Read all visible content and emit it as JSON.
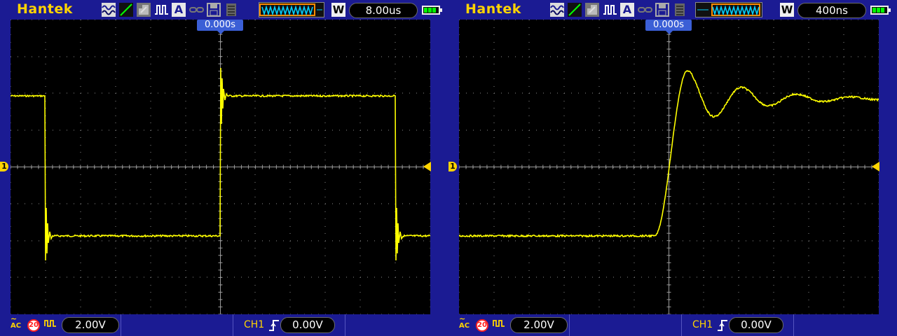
{
  "left": {
    "brand": "Hantek",
    "timebase": "8.00us",
    "trigger_time": "0.000s",
    "ch1_marker": "1",
    "coupling": "AC",
    "bw_limit": "20",
    "volts_div": "2.00V",
    "trigger_source": "CH1",
    "trigger_level": "0.00V",
    "acquire_mode": "W",
    "battery_cells": 3
  },
  "right": {
    "brand": "Hantek",
    "timebase": "400ns",
    "trigger_time": "0.000s",
    "ch1_marker": "1",
    "coupling": "AC",
    "bw_limit": "20",
    "volts_div": "2.00V",
    "trigger_source": "CH1",
    "trigger_level": "0.00V",
    "acquire_mode": "W",
    "battery_cells": 3
  },
  "colors": {
    "trace": "#ffff00",
    "brand": "#ffd400",
    "frame": "#1b1b93",
    "trigger_flag": "#3b5fd6",
    "grid_dot": "#8a8a8a"
  },
  "icons": [
    "math-wave-icon",
    "slope-icon",
    "grey-display-icon",
    "pulse-icon",
    "auto-icon",
    "link-icon",
    "save-icon",
    "list-icon",
    "memory-window-icon",
    "battery-icon"
  ]
}
